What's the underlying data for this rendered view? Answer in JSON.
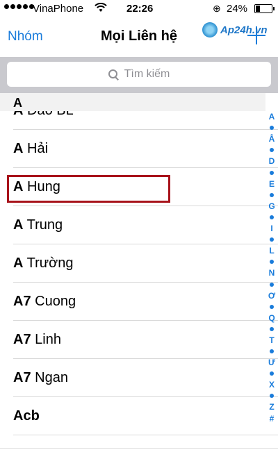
{
  "status_bar": {
    "carrier": "VinaPhone",
    "time": "22:26",
    "battery_percent": "24%",
    "battery_level": 0.24,
    "lock_icon": "rotation-lock-icon"
  },
  "watermark": {
    "text": "Ap24h.vn"
  },
  "nav": {
    "left_label": "Nhóm",
    "title": "Mọi Liên hệ",
    "add_icon": "plus-icon"
  },
  "search": {
    "placeholder": "Tìm kiếm"
  },
  "section": {
    "header": "A"
  },
  "contacts": [
    {
      "bold": "A",
      "rest": " Đảo BL"
    },
    {
      "bold": "A",
      "rest": " Hải"
    },
    {
      "bold": "A",
      "rest": " Hung"
    },
    {
      "bold": "A",
      "rest": " Trung"
    },
    {
      "bold": "A",
      "rest": " Trường"
    },
    {
      "bold": "A7",
      "rest": " Cuong"
    },
    {
      "bold": "A7",
      "rest": " Linh"
    },
    {
      "bold": "A7",
      "rest": " Ngan"
    },
    {
      "bold": "Acb",
      "rest": ""
    }
  ],
  "index": [
    "A",
    "•",
    "Â",
    "•",
    "D",
    "•",
    "E",
    "•",
    "G",
    "•",
    "I",
    "•",
    "L",
    "•",
    "N",
    "•",
    "Ơ",
    "•",
    "Q",
    "•",
    "T",
    "•",
    "Ư",
    "•",
    "X",
    "•",
    "Z",
    "#"
  ]
}
